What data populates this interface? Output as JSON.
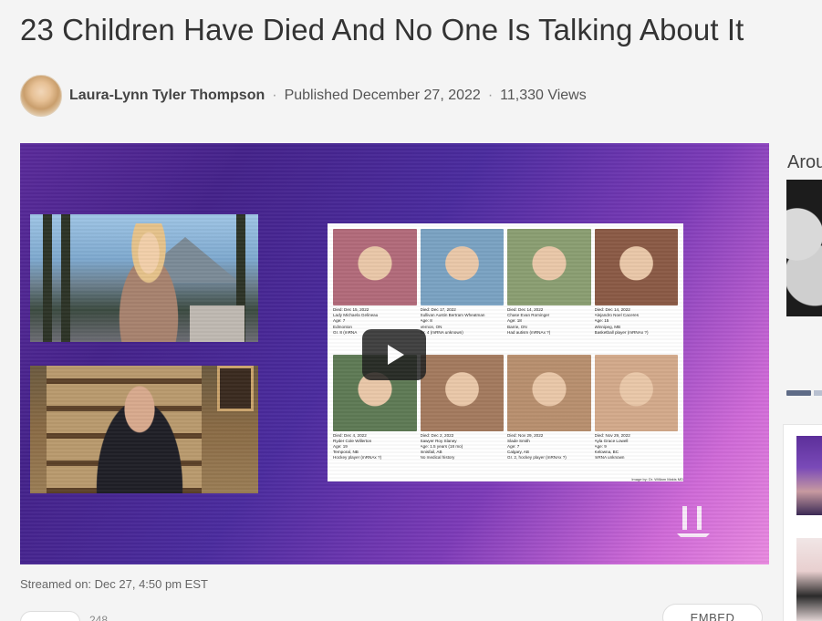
{
  "article": {
    "title": "23 Children Have Died And No One Is Talking About It",
    "author": "Laura-Lynn Tyler Thompson",
    "separator": "·",
    "published": "Published December 27, 2022",
    "views": "11,330 Views"
  },
  "video": {
    "play_icon": "play-icon",
    "streamed": "Streamed on: Dec 27, 4:50 pm EST",
    "credit": "Image by: Dr. William Makis MD",
    "children": [
      {
        "line1": "Died: Dec 15, 2022",
        "line2": "Lady Michaela Gelineau",
        "line3": "Age: 7",
        "line4": "Edmonton",
        "line5": "Gr. 8 (mRNA",
        "photo_color": "#b26a7a"
      },
      {
        "line1": "Died: Dec 17, 2022",
        "line2": "Sullivan Austin Bertram Wheatman",
        "line3": "Age: 8",
        "line4": "Vernon, ON",
        "line5": "Gr. 4 (mRNA unknown)",
        "photo_color": "#7aa2c2"
      },
      {
        "line1": "Died: Dec 14, 2022",
        "line2": "Chase Evan Rominger",
        "line3": "Age: 18",
        "line4": "Barrie, ON",
        "line5": "Had autism (mRNAx ?)",
        "photo_color": "#8a9e72"
      },
      {
        "line1": "Died: Dec 14, 2022",
        "line2": "Alejandro Noel Caceres",
        "line3": "Age: 15",
        "line4": "Winnipeg, MB",
        "line5": "Basketball player (mRNAx ?)",
        "photo_color": "#8a5a45"
      },
      {
        "line1": "Died: Dec 4, 2022",
        "line2": "Ryder Cole Willerton",
        "line3": "Age: 19",
        "line4": "Temporal, NB",
        "line5": "Hockey player (mRNAx ?)",
        "photo_color": "#5e7a55"
      },
      {
        "line1": "Died: Dec 2, 2022",
        "line2": "Sawyer Roy Slaney",
        "line3": "Age: 1.5 years (18 mo)",
        "line4": "Innisfail, AB",
        "line5": "No medical history",
        "photo_color": "#a37a5e"
      },
      {
        "line1": "Died: Nov 29, 2022",
        "line2": "Slade Smith",
        "line3": "Age: 7",
        "line4": "Calgary, AB",
        "line5": "Gr. 2, hockey player (mRNAx ?)",
        "photo_color": "#b88f6e"
      },
      {
        "line1": "Died: Nov 29, 2022",
        "line2": "Ayla Grace Lowell",
        "line3": "Age: 9",
        "line4": "Kelowna, BC",
        "line5": "mRNA unknown",
        "photo_color": "#d3a98a"
      }
    ]
  },
  "actions": {
    "count_text": "248 ...",
    "embed_label": "EMBED"
  },
  "sidebar": {
    "title": "Arou"
  }
}
